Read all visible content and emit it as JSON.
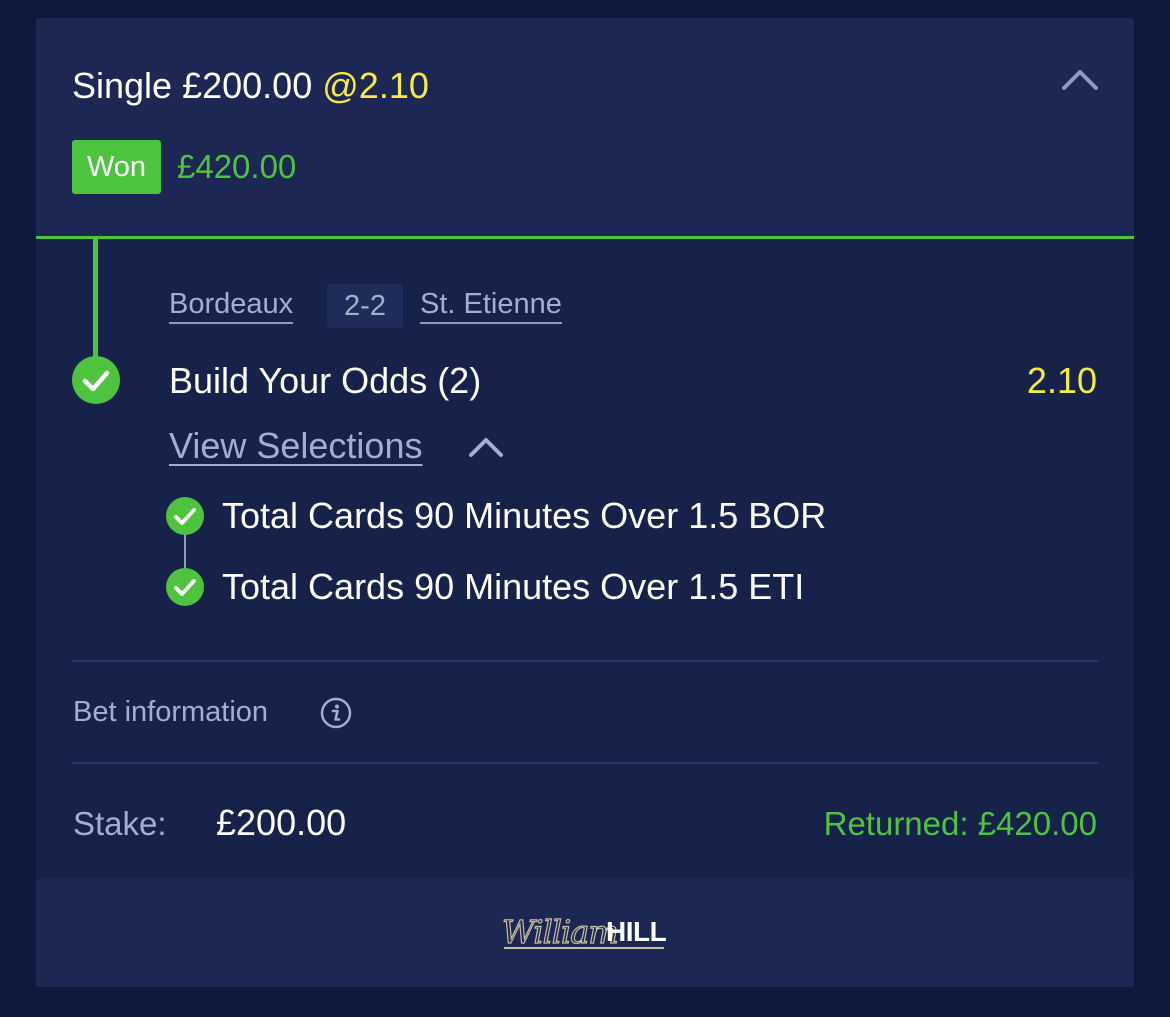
{
  "bet": {
    "type_label": "Single",
    "stake_header": "£200.00",
    "odds_header": "@2.10",
    "status": "Won",
    "won_amount": "£420.00"
  },
  "event": {
    "home_team": "Bordeaux",
    "score": "2-2",
    "away_team": "St. Etienne",
    "market": "Build Your Odds (2)",
    "market_odds": "2.10",
    "view_selections_label": "View Selections",
    "selections": [
      {
        "label": "Total Cards 90 Minutes Over 1.5 BOR",
        "status": "won"
      },
      {
        "label": "Total Cards 90 Minutes Over 1.5 ETI",
        "status": "won"
      }
    ]
  },
  "info": {
    "bet_information_label": "Bet information"
  },
  "summary": {
    "stake_label": "Stake:",
    "stake_value": "£200.00",
    "returned_label": "Returned: £420.00"
  },
  "footer": {
    "logo_script": "William",
    "logo_bold": "HILL"
  },
  "colors": {
    "background": "#0d1a3d",
    "card": "#16224a",
    "header": "#1c2754",
    "win_green": "#4ec33d",
    "odds_yellow": "#f5ea3f",
    "muted_text": "#a3aed0"
  },
  "icons": {
    "collapse": "chevron-up-icon",
    "selections_toggle": "chevron-up-icon",
    "result": "check-circle-icon",
    "info": "info-icon"
  }
}
